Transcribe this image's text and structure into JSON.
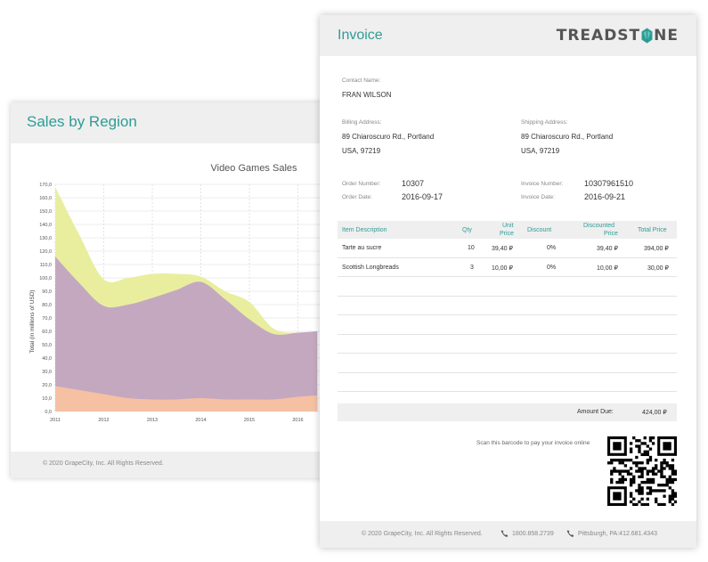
{
  "sales_card": {
    "title": "Sales by Region",
    "footer": "© 2020 GrapeCity, Inc. All Rights Reserved."
  },
  "chart_data": {
    "type": "area",
    "title": "Video Games Sales",
    "xlabel": "",
    "ylabel": "Total (in millions of USD)",
    "ylim": [
      0,
      170
    ],
    "yticks": [
      "0,0",
      "10,0",
      "20,0",
      "30,0",
      "40,0",
      "50,0",
      "60,0",
      "70,0",
      "80,0",
      "90,0",
      "100,0",
      "110,0",
      "120,0",
      "130,0",
      "140,0",
      "150,0",
      "160,0",
      "170,0"
    ],
    "x": [
      2011,
      2011.5,
      2012,
      2012.5,
      2013,
      2013.5,
      2014,
      2014.5,
      2015,
      2015.5,
      2016,
      2016.4
    ],
    "xtick_labels": [
      "2011",
      "2012",
      "2013",
      "2014",
      "2015",
      "2016"
    ],
    "grid": true,
    "stacked": true,
    "series": [
      {
        "values": [
          19,
          16,
          13,
          10,
          9,
          9,
          10,
          9,
          9,
          9,
          11,
          12
        ],
        "color": "#f5c1a2"
      },
      {
        "values": [
          97,
          80,
          66,
          70,
          76,
          82,
          87,
          75,
          60,
          49,
          48,
          48
        ],
        "color": "#c4a8c0"
      },
      {
        "values": [
          52,
          36,
          20,
          20,
          18,
          12,
          4,
          6,
          13,
          4,
          0,
          0
        ],
        "color": "#e9ee9f"
      }
    ]
  },
  "invoice": {
    "title": "Invoice",
    "logo_left": "TREADST",
    "logo_right": "NE",
    "contact_label": "Contact Name:",
    "contact_value": "FRAN WILSON",
    "billing_label": "Billing Address:",
    "billing_line1": "89 Chiaroscuro Rd., Portland",
    "billing_line2": "USA, 97219",
    "shipping_label": "Shipping Address:",
    "shipping_line1": "89 Chiaroscuro Rd., Portland",
    "shipping_line2": "USA, 97219",
    "order_number_label": "Order Number:",
    "order_number": "10307",
    "order_date_label": "Order Date:",
    "order_date": "2016-09-17",
    "invoice_number_label": "Invoice Number:",
    "invoice_number": "10307961510",
    "invoice_date_label": "Invoice Date:",
    "invoice_date": "2016-09-21",
    "columns": {
      "description": "Item Description",
      "qty": "Qty",
      "unit_price_1": "Unit",
      "unit_price_2": "Price",
      "discount": "Discount",
      "discounted_1": "Discounted",
      "discounted_2": "Price",
      "total": "Total Price"
    },
    "items": [
      {
        "description": "Tarte au sucre",
        "qty": "10",
        "unit_price": "39,40 ₽",
        "discount": "0%",
        "discounted": "39,40 ₽",
        "total": "394,00 ₽"
      },
      {
        "description": "Scottish Longbreads",
        "qty": "3",
        "unit_price": "10,00 ₽",
        "discount": "0%",
        "discounted": "10,00 ₽",
        "total": "30,00 ₽"
      }
    ],
    "amount_due_label": "Amount Due:",
    "amount_due": "424,00 ₽",
    "scan_text": "Scan this barcode to pay your invoice online",
    "footer_copyright": "© 2020 GrapeCity, Inc. All Rights Reserved.",
    "footer_phone": "1800.858.2739",
    "footer_phone2": "Pittsburgh, PA:412.681.4343",
    "icons": {
      "phone": "phone-icon",
      "logo_gem": "gem-icon",
      "qr": "qr-code-icon"
    },
    "accent_color": "#2e9c95"
  }
}
